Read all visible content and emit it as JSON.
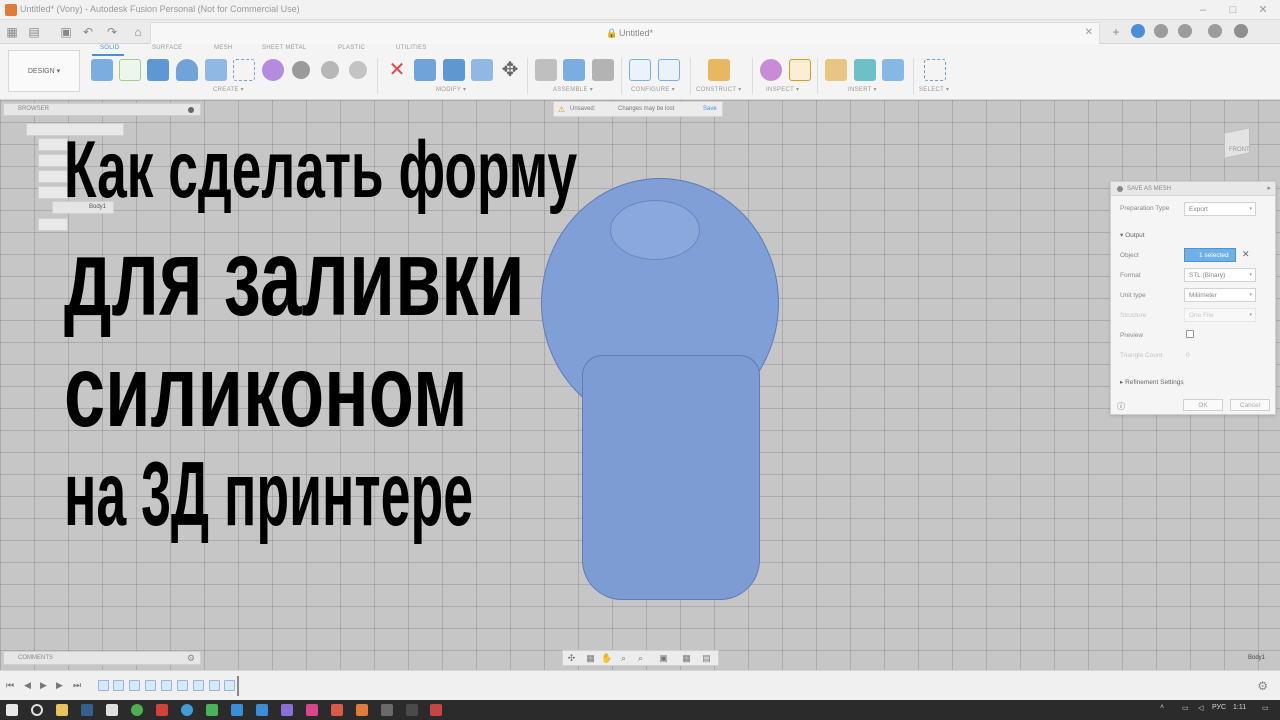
{
  "window": {
    "title": "Untitled* (Vony) - Autodesk Fusion Personal (Not for Commercial Use)"
  },
  "document_tab": {
    "name": "Untitled*"
  },
  "ribbon": {
    "workspace": "DESIGN ▾",
    "tabs": [
      "SOLID",
      "SURFACE",
      "MESH",
      "SHEET METAL",
      "PLASTIC",
      "UTILITIES"
    ],
    "active_tab": "SOLID",
    "groups": [
      "CREATE ▾",
      "MODIFY ▾",
      "ASSEMBLE ▾",
      "CONFIGURE ▾",
      "CONSTRUCT ▾",
      "INSPECT ▾",
      "INSERT ▾",
      "SELECT ▾"
    ]
  },
  "browser": {
    "title": "BROWSER",
    "body_item": "Body1"
  },
  "unsaved_bar": {
    "label": "Unsaved:",
    "message": "Changes may be lost",
    "save": "Save"
  },
  "viewcube": {
    "face": "FRONT"
  },
  "dialog": {
    "title": "SAVE AS MESH",
    "preparation_label": "Preparation Type",
    "preparation_value": "Export",
    "output_header": "Output",
    "object_label": "Object",
    "object_value": "1 selected",
    "format_label": "Format",
    "format_value": "STL (Binary)",
    "unit_label": "Unit type",
    "unit_value": "Millimeter",
    "structure_label": "Structure",
    "structure_value": "One File",
    "preview_label": "Preview",
    "triangle_label": "Triangle Count",
    "triangle_value": "0",
    "refinement_label": "Refinement Settings",
    "ok": "OK",
    "cancel": "Cancel"
  },
  "overlay_title": {
    "line1": "Как сделать форму",
    "line2": "для заливки",
    "line3": "силиконом",
    "line4": "на 3Д принтере"
  },
  "comments": {
    "title": "COMMENTS"
  },
  "viewport_label": "Body1",
  "taskbar": {
    "tray_lang": "РУС",
    "tray_time": "1:11"
  },
  "colors": {
    "accent": "#4a8fd6",
    "model": "#7f9fd6",
    "viewport": "#c6c6c6",
    "taskbar": "#2b2b2b"
  }
}
